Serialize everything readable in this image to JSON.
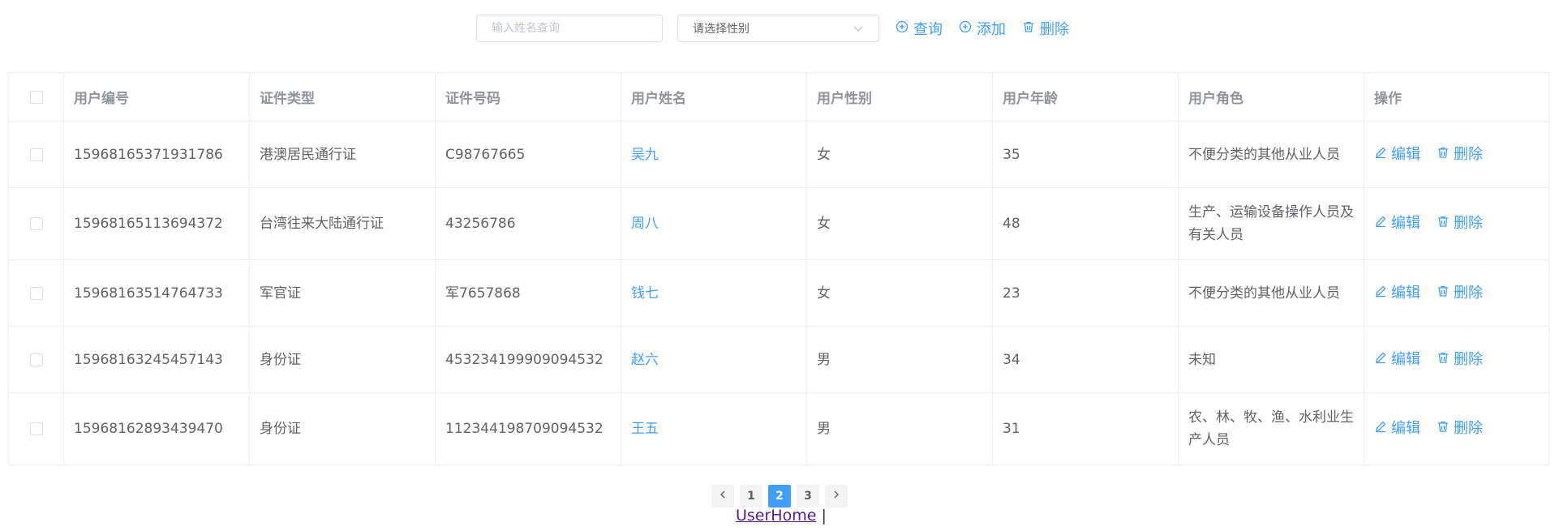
{
  "toolbar": {
    "search_placeholder": "输入姓名查询",
    "gender_select_placeholder": "请选择性别",
    "query_label": "查询",
    "add_label": "添加",
    "delete_label": "删除"
  },
  "table": {
    "headers": [
      "用户编号",
      "证件类型",
      "证件号码",
      "用户姓名",
      "用户性别",
      "用户年龄",
      "用户角色",
      "操作"
    ],
    "rows": [
      {
        "id": "15968165371931786",
        "cert_type": "港澳居民通行证",
        "cert_no": "C98767665",
        "name": "吴九",
        "gender": "女",
        "age": "35",
        "role": "不便分类的其他从业人员"
      },
      {
        "id": "15968165113694372",
        "cert_type": "台湾往来大陆通行证",
        "cert_no": "43256786",
        "name": "周八",
        "gender": "女",
        "age": "48",
        "role": "生产、运输设备操作人员及有关人员"
      },
      {
        "id": "15968163514764733",
        "cert_type": "军官证",
        "cert_no": "军7657868",
        "name": "钱七",
        "gender": "女",
        "age": "23",
        "role": "不便分类的其他从业人员"
      },
      {
        "id": "15968163245457143",
        "cert_type": "身份证",
        "cert_no": "453234199909094532",
        "name": "赵六",
        "gender": "男",
        "age": "34",
        "role": "未知"
      },
      {
        "id": "15968162893439470",
        "cert_type": "身份证",
        "cert_no": "112344198709094532",
        "name": "王五",
        "gender": "男",
        "age": "31",
        "role": "农、林、牧、渔、水利业生产人员"
      }
    ],
    "edit_label": "编辑",
    "delete_label": "删除"
  },
  "pagination": {
    "pages": [
      "1",
      "2",
      "3"
    ],
    "current": "2"
  },
  "footer": {
    "link": "UserHome",
    "separator": "|"
  },
  "colors": {
    "accent": "#409eff",
    "border": "#ebeef5",
    "text": "#606266",
    "header_text": "#909399"
  }
}
